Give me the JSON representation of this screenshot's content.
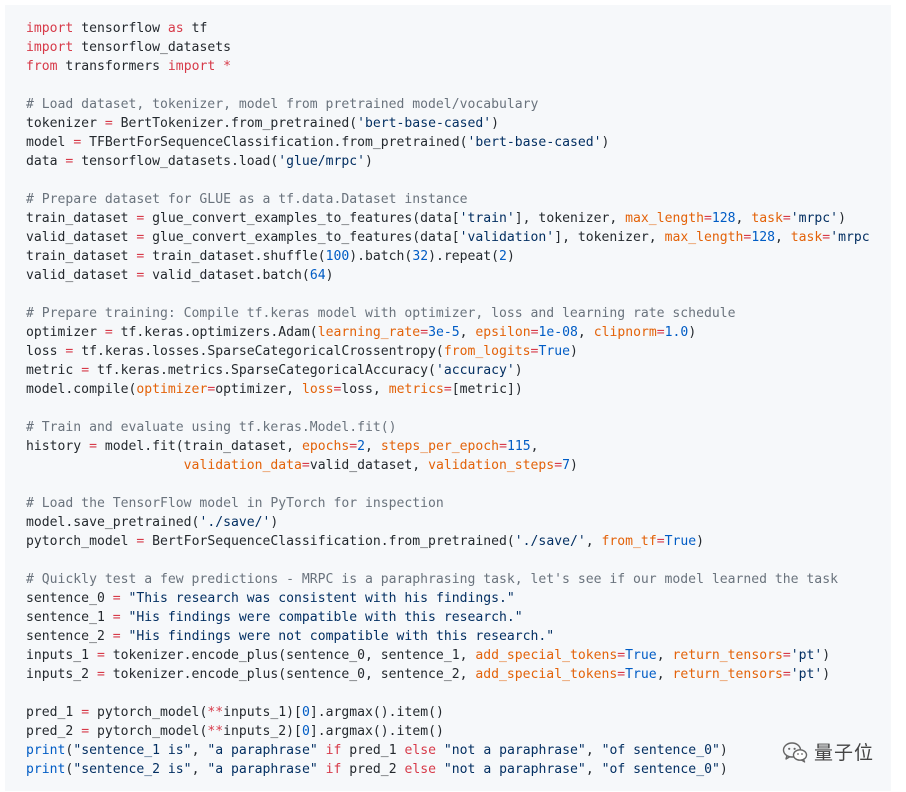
{
  "code_lines": [
    [
      {
        "t": "kw",
        "v": "import"
      },
      {
        "t": "pl",
        "v": " tensorflow "
      },
      {
        "t": "kw",
        "v": "as"
      },
      {
        "t": "pl",
        "v": " tf"
      }
    ],
    [
      {
        "t": "kw",
        "v": "import"
      },
      {
        "t": "pl",
        "v": " tensorflow_datasets"
      }
    ],
    [
      {
        "t": "kw",
        "v": "from"
      },
      {
        "t": "pl",
        "v": " transformers "
      },
      {
        "t": "kw",
        "v": "import"
      },
      {
        "t": "pl",
        "v": " "
      },
      {
        "t": "kw",
        "v": "*"
      }
    ],
    [],
    [
      {
        "t": "cm",
        "v": "# Load dataset, tokenizer, model from pretrained model/vocabulary"
      }
    ],
    [
      {
        "t": "pl",
        "v": "tokenizer "
      },
      {
        "t": "kw",
        "v": "="
      },
      {
        "t": "pl",
        "v": " BertTokenizer.from_pretrained("
      },
      {
        "t": "str",
        "v": "'bert-base-cased'"
      },
      {
        "t": "pl",
        "v": ")"
      }
    ],
    [
      {
        "t": "pl",
        "v": "model "
      },
      {
        "t": "kw",
        "v": "="
      },
      {
        "t": "pl",
        "v": " TFBertForSequenceClassification.from_pretrained("
      },
      {
        "t": "str",
        "v": "'bert-base-cased'"
      },
      {
        "t": "pl",
        "v": ")"
      }
    ],
    [
      {
        "t": "pl",
        "v": "data "
      },
      {
        "t": "kw",
        "v": "="
      },
      {
        "t": "pl",
        "v": " tensorflow_datasets.load("
      },
      {
        "t": "str",
        "v": "'glue/mrpc'"
      },
      {
        "t": "pl",
        "v": ")"
      }
    ],
    [],
    [
      {
        "t": "cm",
        "v": "# Prepare dataset for GLUE as a tf.data.Dataset instance"
      }
    ],
    [
      {
        "t": "pl",
        "v": "train_dataset "
      },
      {
        "t": "kw",
        "v": "="
      },
      {
        "t": "pl",
        "v": " glue_convert_examples_to_features(data["
      },
      {
        "t": "str",
        "v": "'train'"
      },
      {
        "t": "pl",
        "v": "], tokenizer, "
      },
      {
        "t": "arg",
        "v": "max_length"
      },
      {
        "t": "kw",
        "v": "="
      },
      {
        "t": "num",
        "v": "128"
      },
      {
        "t": "pl",
        "v": ", "
      },
      {
        "t": "arg",
        "v": "task"
      },
      {
        "t": "kw",
        "v": "="
      },
      {
        "t": "str",
        "v": "'mrpc'"
      },
      {
        "t": "pl",
        "v": ")"
      }
    ],
    [
      {
        "t": "pl",
        "v": "valid_dataset "
      },
      {
        "t": "kw",
        "v": "="
      },
      {
        "t": "pl",
        "v": " glue_convert_examples_to_features(data["
      },
      {
        "t": "str",
        "v": "'validation'"
      },
      {
        "t": "pl",
        "v": "], tokenizer, "
      },
      {
        "t": "arg",
        "v": "max_length"
      },
      {
        "t": "kw",
        "v": "="
      },
      {
        "t": "num",
        "v": "128"
      },
      {
        "t": "pl",
        "v": ", "
      },
      {
        "t": "arg",
        "v": "task"
      },
      {
        "t": "kw",
        "v": "="
      },
      {
        "t": "str",
        "v": "'mrpc"
      }
    ],
    [
      {
        "t": "pl",
        "v": "train_dataset "
      },
      {
        "t": "kw",
        "v": "="
      },
      {
        "t": "pl",
        "v": " train_dataset.shuffle("
      },
      {
        "t": "num",
        "v": "100"
      },
      {
        "t": "pl",
        "v": ").batch("
      },
      {
        "t": "num",
        "v": "32"
      },
      {
        "t": "pl",
        "v": ").repeat("
      },
      {
        "t": "num",
        "v": "2"
      },
      {
        "t": "pl",
        "v": ")"
      }
    ],
    [
      {
        "t": "pl",
        "v": "valid_dataset "
      },
      {
        "t": "kw",
        "v": "="
      },
      {
        "t": "pl",
        "v": " valid_dataset.batch("
      },
      {
        "t": "num",
        "v": "64"
      },
      {
        "t": "pl",
        "v": ")"
      }
    ],
    [],
    [
      {
        "t": "cm",
        "v": "# Prepare training: Compile tf.keras model with optimizer, loss and learning rate schedule"
      }
    ],
    [
      {
        "t": "pl",
        "v": "optimizer "
      },
      {
        "t": "kw",
        "v": "="
      },
      {
        "t": "pl",
        "v": " tf.keras.optimizers.Adam("
      },
      {
        "t": "arg",
        "v": "learning_rate"
      },
      {
        "t": "kw",
        "v": "="
      },
      {
        "t": "num",
        "v": "3e-5"
      },
      {
        "t": "pl",
        "v": ", "
      },
      {
        "t": "arg",
        "v": "epsilon"
      },
      {
        "t": "kw",
        "v": "="
      },
      {
        "t": "num",
        "v": "1e-08"
      },
      {
        "t": "pl",
        "v": ", "
      },
      {
        "t": "arg",
        "v": "clipnorm"
      },
      {
        "t": "kw",
        "v": "="
      },
      {
        "t": "num",
        "v": "1.0"
      },
      {
        "t": "pl",
        "v": ")"
      }
    ],
    [
      {
        "t": "pl",
        "v": "loss "
      },
      {
        "t": "kw",
        "v": "="
      },
      {
        "t": "pl",
        "v": " tf.keras.losses.SparseCategoricalCrossentropy("
      },
      {
        "t": "arg",
        "v": "from_logits"
      },
      {
        "t": "kw",
        "v": "="
      },
      {
        "t": "bi",
        "v": "True"
      },
      {
        "t": "pl",
        "v": ")"
      }
    ],
    [
      {
        "t": "pl",
        "v": "metric "
      },
      {
        "t": "kw",
        "v": "="
      },
      {
        "t": "pl",
        "v": " tf.keras.metrics.SparseCategoricalAccuracy("
      },
      {
        "t": "str",
        "v": "'accuracy'"
      },
      {
        "t": "pl",
        "v": ")"
      }
    ],
    [
      {
        "t": "pl",
        "v": "model.compile("
      },
      {
        "t": "arg",
        "v": "optimizer"
      },
      {
        "t": "kw",
        "v": "="
      },
      {
        "t": "pl",
        "v": "optimizer, "
      },
      {
        "t": "arg",
        "v": "loss"
      },
      {
        "t": "kw",
        "v": "="
      },
      {
        "t": "pl",
        "v": "loss, "
      },
      {
        "t": "arg",
        "v": "metrics"
      },
      {
        "t": "kw",
        "v": "="
      },
      {
        "t": "pl",
        "v": "[metric])"
      }
    ],
    [],
    [
      {
        "t": "cm",
        "v": "# Train and evaluate using tf.keras.Model.fit()"
      }
    ],
    [
      {
        "t": "pl",
        "v": "history "
      },
      {
        "t": "kw",
        "v": "="
      },
      {
        "t": "pl",
        "v": " model.fit(train_dataset, "
      },
      {
        "t": "arg",
        "v": "epochs"
      },
      {
        "t": "kw",
        "v": "="
      },
      {
        "t": "num",
        "v": "2"
      },
      {
        "t": "pl",
        "v": ", "
      },
      {
        "t": "arg",
        "v": "steps_per_epoch"
      },
      {
        "t": "kw",
        "v": "="
      },
      {
        "t": "num",
        "v": "115"
      },
      {
        "t": "pl",
        "v": ","
      }
    ],
    [
      {
        "t": "pl",
        "v": "                    "
      },
      {
        "t": "arg",
        "v": "validation_data"
      },
      {
        "t": "kw",
        "v": "="
      },
      {
        "t": "pl",
        "v": "valid_dataset, "
      },
      {
        "t": "arg",
        "v": "validation_steps"
      },
      {
        "t": "kw",
        "v": "="
      },
      {
        "t": "num",
        "v": "7"
      },
      {
        "t": "pl",
        "v": ")"
      }
    ],
    [],
    [
      {
        "t": "cm",
        "v": "# Load the TensorFlow model in PyTorch for inspection"
      }
    ],
    [
      {
        "t": "pl",
        "v": "model.save_pretrained("
      },
      {
        "t": "str",
        "v": "'./save/'"
      },
      {
        "t": "pl",
        "v": ")"
      }
    ],
    [
      {
        "t": "pl",
        "v": "pytorch_model "
      },
      {
        "t": "kw",
        "v": "="
      },
      {
        "t": "pl",
        "v": " BertForSequenceClassification.from_pretrained("
      },
      {
        "t": "str",
        "v": "'./save/'"
      },
      {
        "t": "pl",
        "v": ", "
      },
      {
        "t": "arg",
        "v": "from_tf"
      },
      {
        "t": "kw",
        "v": "="
      },
      {
        "t": "bi",
        "v": "True"
      },
      {
        "t": "pl",
        "v": ")"
      }
    ],
    [],
    [
      {
        "t": "cm",
        "v": "# Quickly test a few predictions - MRPC is a paraphrasing task, let's see if our model learned the task"
      }
    ],
    [
      {
        "t": "pl",
        "v": "sentence_0 "
      },
      {
        "t": "kw",
        "v": "="
      },
      {
        "t": "pl",
        "v": " "
      },
      {
        "t": "str",
        "v": "\"This research was consistent with his findings.\""
      }
    ],
    [
      {
        "t": "pl",
        "v": "sentence_1 "
      },
      {
        "t": "kw",
        "v": "="
      },
      {
        "t": "pl",
        "v": " "
      },
      {
        "t": "str",
        "v": "\"His findings were compatible with this research.\""
      }
    ],
    [
      {
        "t": "pl",
        "v": "sentence_2 "
      },
      {
        "t": "kw",
        "v": "="
      },
      {
        "t": "pl",
        "v": " "
      },
      {
        "t": "str",
        "v": "\"His findings were not compatible with this research.\""
      }
    ],
    [
      {
        "t": "pl",
        "v": "inputs_1 "
      },
      {
        "t": "kw",
        "v": "="
      },
      {
        "t": "pl",
        "v": " tokenizer.encode_plus(sentence_0, sentence_1, "
      },
      {
        "t": "arg",
        "v": "add_special_tokens"
      },
      {
        "t": "kw",
        "v": "="
      },
      {
        "t": "bi",
        "v": "True"
      },
      {
        "t": "pl",
        "v": ", "
      },
      {
        "t": "arg",
        "v": "return_tensors"
      },
      {
        "t": "kw",
        "v": "="
      },
      {
        "t": "str",
        "v": "'pt'"
      },
      {
        "t": "pl",
        "v": ")"
      }
    ],
    [
      {
        "t": "pl",
        "v": "inputs_2 "
      },
      {
        "t": "kw",
        "v": "="
      },
      {
        "t": "pl",
        "v": " tokenizer.encode_plus(sentence_0, sentence_2, "
      },
      {
        "t": "arg",
        "v": "add_special_tokens"
      },
      {
        "t": "kw",
        "v": "="
      },
      {
        "t": "bi",
        "v": "True"
      },
      {
        "t": "pl",
        "v": ", "
      },
      {
        "t": "arg",
        "v": "return_tensors"
      },
      {
        "t": "kw",
        "v": "="
      },
      {
        "t": "str",
        "v": "'pt'"
      },
      {
        "t": "pl",
        "v": ")"
      }
    ],
    [],
    [
      {
        "t": "pl",
        "v": "pred_1 "
      },
      {
        "t": "kw",
        "v": "="
      },
      {
        "t": "pl",
        "v": " pytorch_model("
      },
      {
        "t": "kw",
        "v": "**"
      },
      {
        "t": "pl",
        "v": "inputs_1)["
      },
      {
        "t": "num",
        "v": "0"
      },
      {
        "t": "pl",
        "v": "].argmax().item()"
      }
    ],
    [
      {
        "t": "pl",
        "v": "pred_2 "
      },
      {
        "t": "kw",
        "v": "="
      },
      {
        "t": "pl",
        "v": " pytorch_model("
      },
      {
        "t": "kw",
        "v": "**"
      },
      {
        "t": "pl",
        "v": "inputs_2)["
      },
      {
        "t": "num",
        "v": "0"
      },
      {
        "t": "pl",
        "v": "].argmax().item()"
      }
    ],
    [
      {
        "t": "bi",
        "v": "print"
      },
      {
        "t": "pl",
        "v": "("
      },
      {
        "t": "str",
        "v": "\"sentence_1 is\""
      },
      {
        "t": "pl",
        "v": ", "
      },
      {
        "t": "str",
        "v": "\"a paraphrase\""
      },
      {
        "t": "pl",
        "v": " "
      },
      {
        "t": "kw",
        "v": "if"
      },
      {
        "t": "pl",
        "v": " pred_1 "
      },
      {
        "t": "kw",
        "v": "else"
      },
      {
        "t": "pl",
        "v": " "
      },
      {
        "t": "str",
        "v": "\"not a paraphrase\""
      },
      {
        "t": "pl",
        "v": ", "
      },
      {
        "t": "str",
        "v": "\"of sentence_0\""
      },
      {
        "t": "pl",
        "v": ")"
      }
    ],
    [
      {
        "t": "bi",
        "v": "print"
      },
      {
        "t": "pl",
        "v": "("
      },
      {
        "t": "str",
        "v": "\"sentence_2 is\""
      },
      {
        "t": "pl",
        "v": ", "
      },
      {
        "t": "str",
        "v": "\"a paraphrase\""
      },
      {
        "t": "pl",
        "v": " "
      },
      {
        "t": "kw",
        "v": "if"
      },
      {
        "t": "pl",
        "v": " pred_2 "
      },
      {
        "t": "kw",
        "v": "else"
      },
      {
        "t": "pl",
        "v": " "
      },
      {
        "t": "str",
        "v": "\"not a paraphrase\""
      },
      {
        "t": "pl",
        "v": ", "
      },
      {
        "t": "str",
        "v": "\"of sentence_0\""
      },
      {
        "t": "pl",
        "v": ")"
      }
    ]
  ],
  "colors": {
    "keyword": "#d73a49",
    "comment": "#6a737d",
    "string": "#032f62",
    "argument": "#e36209",
    "number": "#005cc5",
    "plain": "#24292e",
    "panel_background": "#f6f8fa"
  },
  "watermark": {
    "icon": "wechat-icon",
    "text": "量子位"
  }
}
